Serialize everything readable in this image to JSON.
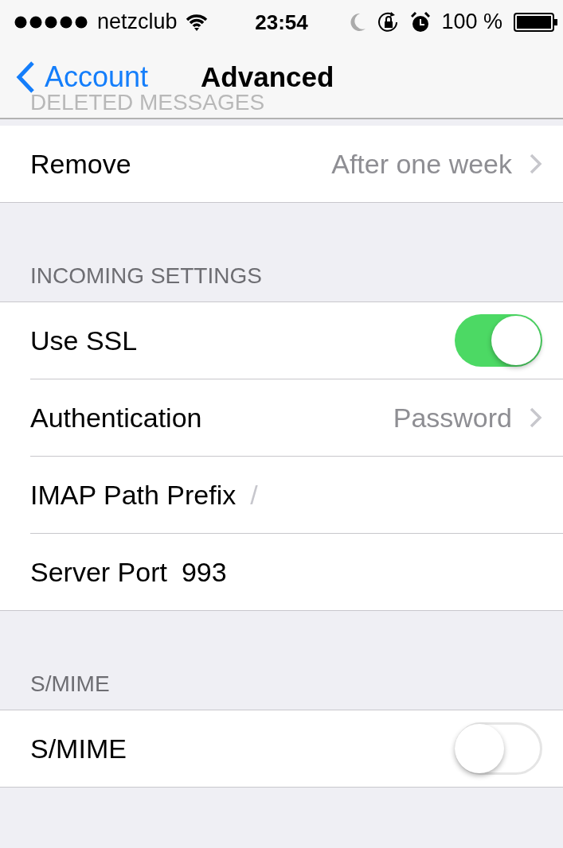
{
  "status_bar": {
    "carrier": "netzclub",
    "time": "23:54",
    "battery": "100 %"
  },
  "nav_bar": {
    "back": "Account",
    "title": "Advanced",
    "underlying_header": "DELETED MESSAGES"
  },
  "sections": [
    {
      "rows": [
        {
          "kind": "disclosure",
          "label": "Remove",
          "value": "After one week"
        }
      ]
    },
    {
      "header": "INCOMING SETTINGS",
      "rows": [
        {
          "kind": "toggle",
          "label": "Use SSL",
          "on": true
        },
        {
          "kind": "disclosure",
          "label": "Authentication",
          "value": "Password"
        },
        {
          "kind": "field",
          "label": "IMAP Path Prefix",
          "placeholder": "/"
        },
        {
          "kind": "field",
          "label": "Server Port",
          "value": "993"
        }
      ]
    },
    {
      "header": "S/MIME",
      "rows": [
        {
          "kind": "toggle",
          "label": "S/MIME",
          "on": false
        }
      ]
    }
  ]
}
